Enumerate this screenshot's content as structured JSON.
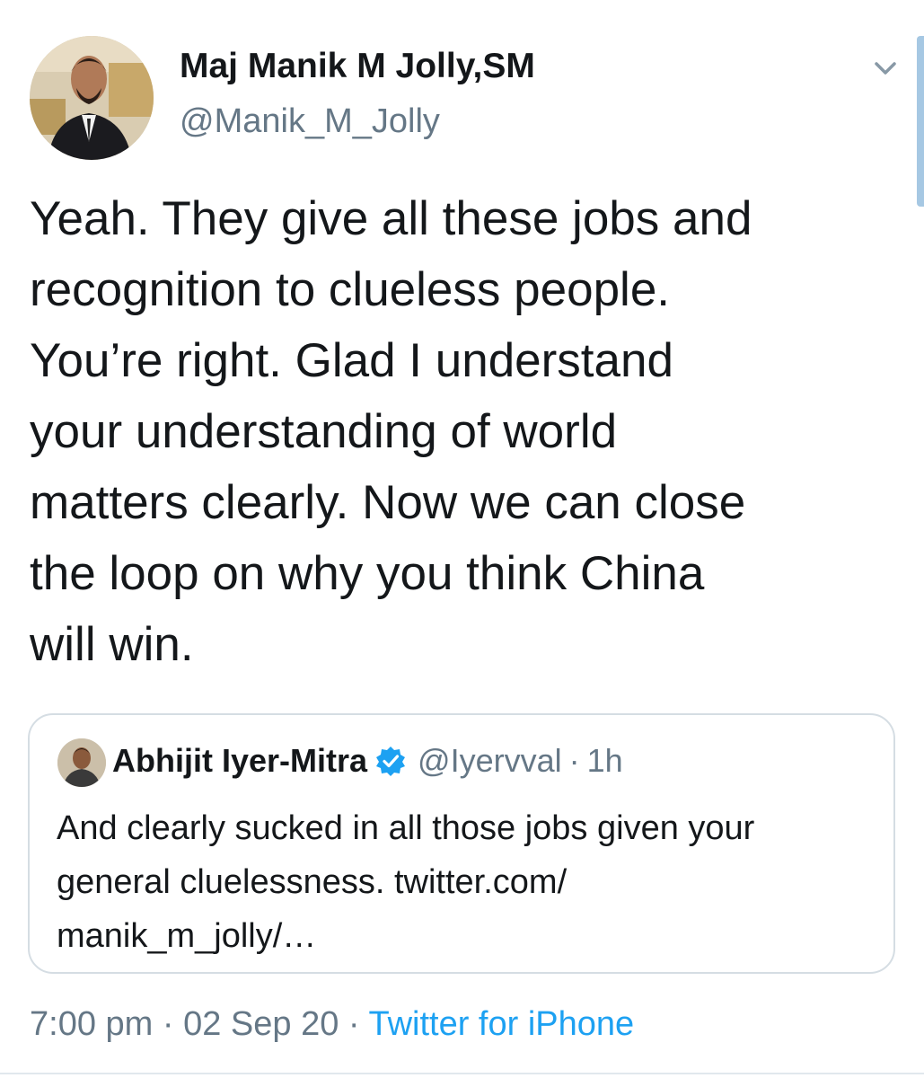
{
  "tweet": {
    "display_name": "Maj Manik M Jolly,SM",
    "handle": "@Manik_M_Jolly",
    "text": "Yeah. They give all these jobs and\nrecognition to clueless people.\nYou’re right. Glad I understand\nyour understanding of world\nmatters clearly. Now we can close\nthe loop on why you think China\nwill win.",
    "time": "7:00 pm",
    "date": "02 Sep 20",
    "source": "Twitter for iPhone",
    "separator": "·"
  },
  "quoted_tweet": {
    "display_name": "Abhijit Iyer-Mitra",
    "handle": "@Iyervval",
    "separator": "·",
    "age": "1h",
    "text": "And clearly sucked in all those jobs given your\ngeneral cluelessness. twitter.com/\nmanik_m_jolly/…",
    "verified": true
  },
  "icons": {
    "menu": "chevron-down-icon",
    "verified": "verified-badge-icon"
  },
  "colors": {
    "accent": "#1da1f2",
    "secondary_text": "#657786",
    "border": "#d5dde3"
  }
}
